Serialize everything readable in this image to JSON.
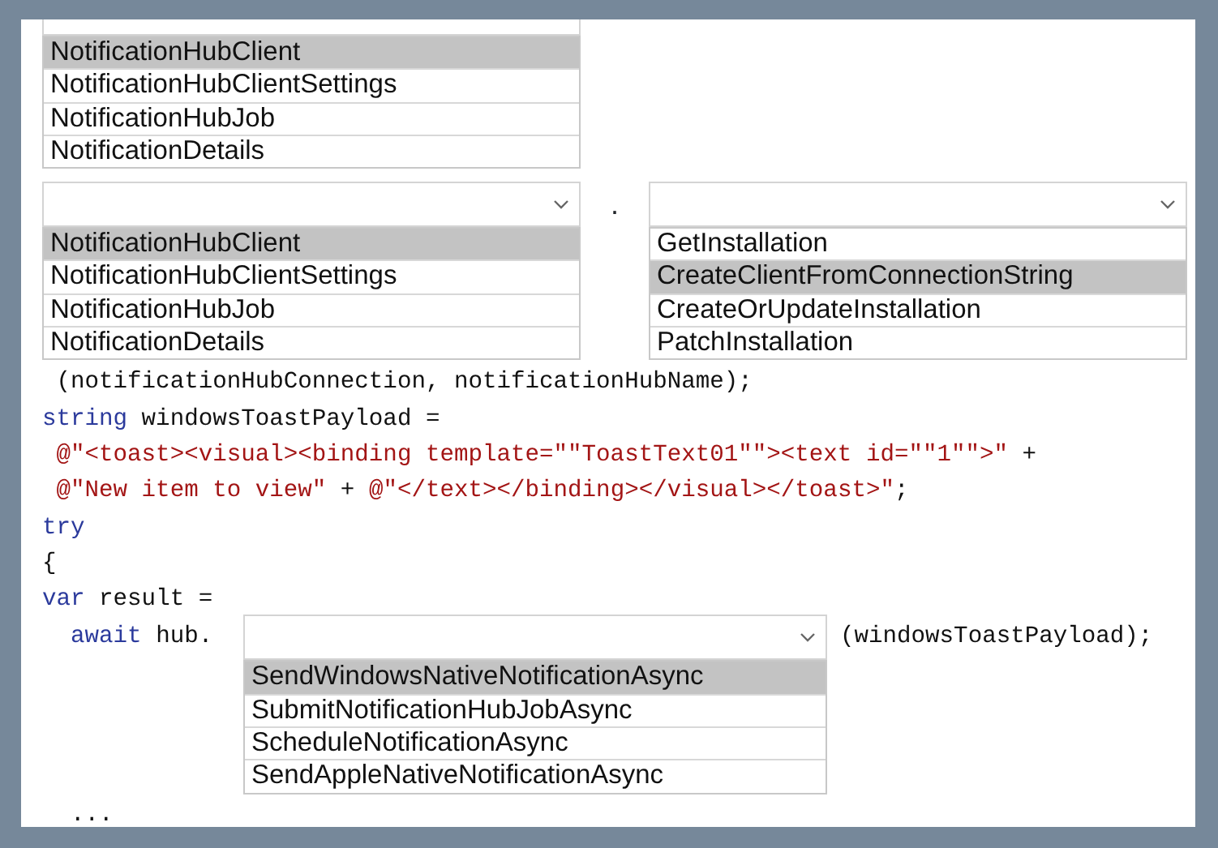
{
  "dropdown_1": {
    "clipped": true,
    "options": [
      {
        "label": "NotificationHubClient",
        "selected": true
      },
      {
        "label": "NotificationHubClientSettings",
        "selected": false
      },
      {
        "label": "NotificationHubJob",
        "selected": false
      },
      {
        "label": "NotificationDetails",
        "selected": false
      }
    ]
  },
  "member_access": {
    "separator": ".",
    "dropdowns": [
      {
        "clipped": false,
        "options": [
          {
            "label": "NotificationHubClient",
            "selected": true
          },
          {
            "label": "NotificationHubClientSettings",
            "selected": false
          },
          {
            "label": "NotificationHubJob",
            "selected": false
          },
          {
            "label": "NotificationDetails",
            "selected": false
          }
        ]
      },
      {
        "clipped": false,
        "options": [
          {
            "label": "GetInstallation",
            "selected": false
          },
          {
            "label": "CreateClientFromConnectionString",
            "selected": true
          },
          {
            "label": "CreateOrUpdateInstallation",
            "selected": false
          },
          {
            "label": "PatchInstallation",
            "selected": false
          }
        ]
      }
    ]
  },
  "code_lines": [
    {
      "segments": [
        {
          "kind": "plain",
          "text": " (notificationHubConnection, notificationHubName);"
        }
      ]
    },
    {
      "segments": [
        {
          "kind": "keyword",
          "text": "string"
        },
        {
          "kind": "plain",
          "text": " windowsToastPayload ="
        }
      ]
    },
    {
      "segments": [
        {
          "kind": "string",
          "text": " @\"<toast><visual><binding template=\"\"ToastText01\"\"><text id=\"\"1\"\">\""
        },
        {
          "kind": "plain",
          "text": " +"
        }
      ]
    },
    {
      "segments": [
        {
          "kind": "string",
          "text": " @\"New item to view\""
        },
        {
          "kind": "plain",
          "text": " + "
        },
        {
          "kind": "string",
          "text": "@\"</text></binding></visual></toast>\""
        },
        {
          "kind": "plain",
          "text": ";"
        }
      ]
    },
    {
      "segments": [
        {
          "kind": "keyword",
          "text": "try"
        }
      ]
    },
    {
      "segments": [
        {
          "kind": "plain",
          "text": "{"
        }
      ]
    },
    {
      "segments": [
        {
          "kind": "keyword",
          "text": "var"
        },
        {
          "kind": "plain",
          "text": " result ="
        }
      ]
    }
  ],
  "send_line": {
    "prefix": [
      {
        "kind": "keyword",
        "text": "  await"
      },
      {
        "kind": "plain",
        "text": " hub."
      }
    ],
    "dropdown": {
      "clipped": false,
      "options": [
        {
          "label": "SendWindowsNativeNotificationAsync",
          "selected": true
        },
        {
          "label": "SubmitNotificationHubJobAsync",
          "selected": false
        },
        {
          "label": "ScheduleNotificationAsync",
          "selected": false
        },
        {
          "label": "SendAppleNativeNotificationAsync",
          "selected": false
        }
      ]
    },
    "suffix": [
      {
        "kind": "plain",
        "text": "(windowsToastPayload);"
      }
    ]
  },
  "ellipsis": "  ..."
}
